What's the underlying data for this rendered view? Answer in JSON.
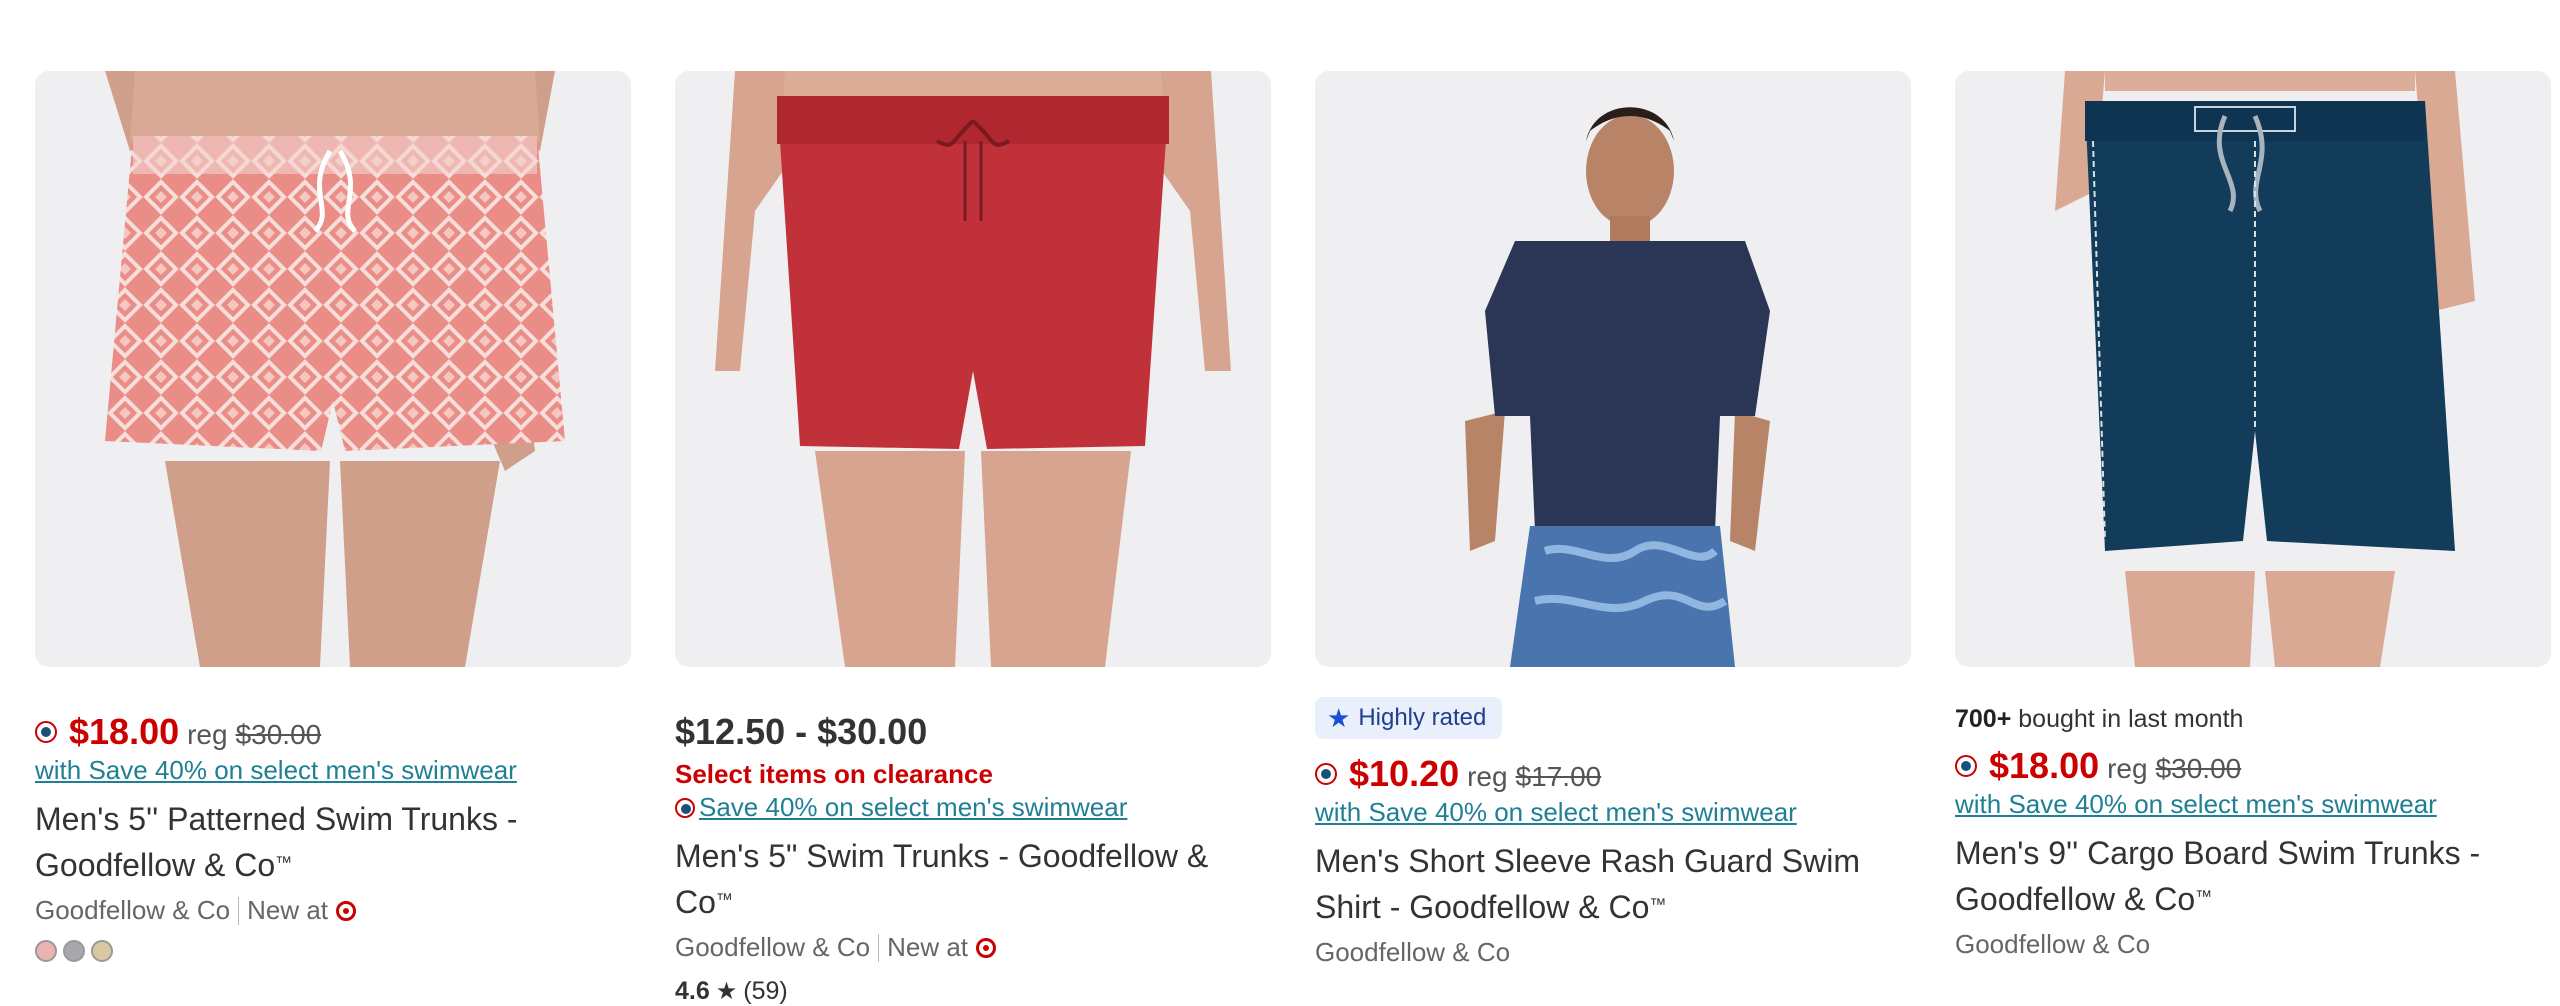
{
  "products": [
    {
      "price": "$18.00",
      "reg_label": "reg",
      "reg_price": "$30.00",
      "promo": "with Save 40% on select men's swimwear",
      "title": "Men's 5'' Patterned Swim Trunks - Goodfellow & Co",
      "trademark": "™",
      "brand": "Goodfellow & Co",
      "new_at": "New at",
      "swatch_colors": [
        "#e9b3b0",
        "#a6a8ab",
        "#d8c9a0"
      ]
    },
    {
      "price_range": "$12.50 - $30.00",
      "clearance": "Select items on clearance",
      "promo": "Save 40% on select men's swimwear",
      "title": "Men's 5\" Swim Trunks - Goodfellow & Co",
      "trademark": "™",
      "brand": "Goodfellow & Co",
      "new_at": "New at",
      "rating": "4.6",
      "review_count": "(59)"
    },
    {
      "badge": "Highly rated",
      "price": "$10.20",
      "reg_label": "reg",
      "reg_price": "$17.00",
      "promo": "with Save 40% on select men's swimwear",
      "title": "Men's Short Sleeve Rash Guard Swim Shirt - Goodfellow & Co",
      "trademark": "™",
      "brand": "Goodfellow & Co"
    },
    {
      "bought_count": "700+",
      "bought_text": "bought in last month",
      "price": "$18.00",
      "reg_label": "reg",
      "reg_price": "$30.00",
      "promo": "with Save 40% on select men's swimwear",
      "title": "Men's 9'' Cargo Board Swim Trunks - Goodfellow & Co",
      "trademark": "™",
      "brand": "Goodfellow & Co"
    }
  ],
  "colors": {
    "sale_red": "#cc0000",
    "promo_teal": "#1f7f95",
    "badge_bg": "#e9f0fb",
    "image_bg": "#efeff1"
  }
}
